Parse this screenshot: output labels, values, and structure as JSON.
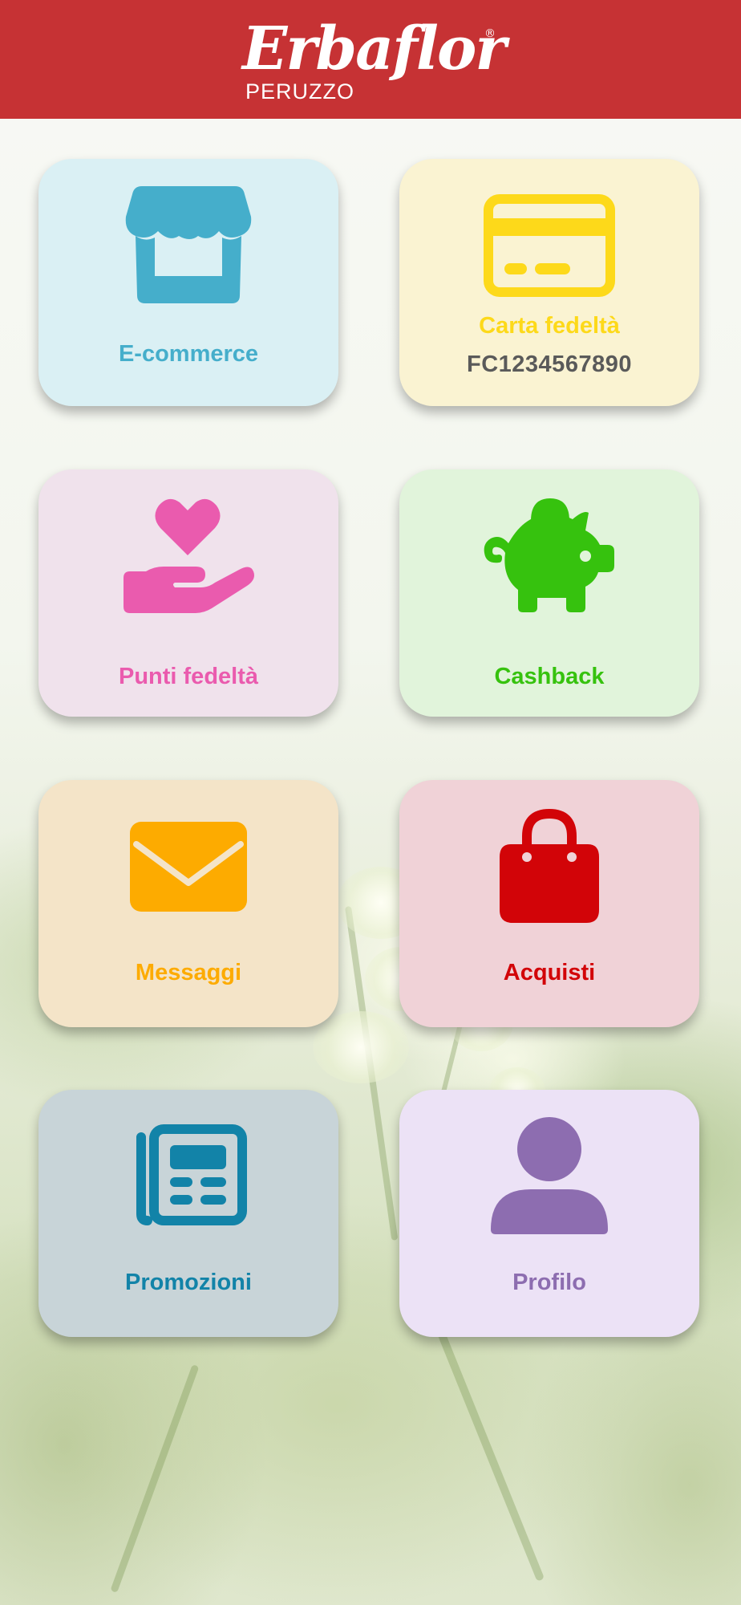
{
  "header": {
    "logo_script": "Erbaflor",
    "logo_sub": "PERUZZO",
    "logo_reg": "®",
    "background_color": "#c63234"
  },
  "tiles": [
    {
      "label": "E-commerce",
      "icon": "storefront-icon",
      "color": "#45aecb",
      "background": "#daf0f4"
    },
    {
      "label": "Carta fedeltà",
      "value": "FC1234567890",
      "icon": "credit-card-icon",
      "color": "#fdd91a",
      "background": "#faf3d2"
    },
    {
      "label": "Punti fedeltà",
      "icon": "hand-heart-icon",
      "color": "#ea5bae",
      "background": "#f0e2ec"
    },
    {
      "label": "Cashback",
      "icon": "piggy-bank-icon",
      "color": "#36c20e",
      "background": "#e1f4db"
    },
    {
      "label": "Messaggi",
      "icon": "envelope-icon",
      "color": "#fdab00",
      "background": "#f4e4c8"
    },
    {
      "label": "Acquisti",
      "icon": "shopping-bag-icon",
      "color": "#d20408",
      "background": "#f0d2d7"
    },
    {
      "label": "Promozioni",
      "icon": "newspaper-icon",
      "color": "#1283a8",
      "background": "#c8d4d8"
    },
    {
      "label": "Profilo",
      "icon": "user-icon",
      "color": "#8d6db0",
      "background": "#ece2f6"
    }
  ]
}
